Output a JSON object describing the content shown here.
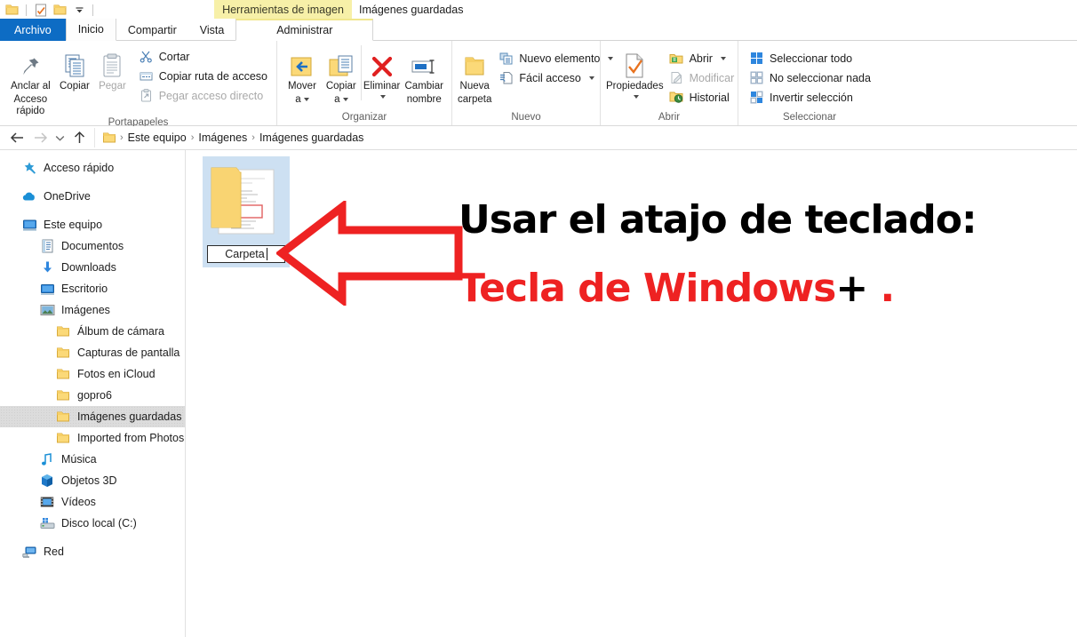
{
  "window": {
    "title": "Imágenes guardadas",
    "contextual_tab_header": "Herramientas de imagen",
    "quick_access": [
      {
        "name": "folder-icon",
        "label": "Carpeta"
      },
      {
        "name": "properties-icon",
        "label": "Propiedades"
      },
      {
        "name": "new-folder-icon",
        "label": "Nueva carpeta"
      },
      {
        "name": "chevron-down-icon",
        "label": "Personalizar barra de herramientas de acceso rápido"
      }
    ]
  },
  "tabs": [
    {
      "id": "archivo",
      "label": "Archivo",
      "state": "file"
    },
    {
      "id": "inicio",
      "label": "Inicio",
      "state": "active"
    },
    {
      "id": "compartir",
      "label": "Compartir",
      "state": "normal"
    },
    {
      "id": "vista",
      "label": "Vista",
      "state": "normal"
    },
    {
      "id": "administrar",
      "label": "Administrar",
      "state": "contextual"
    }
  ],
  "ribbon": {
    "groups": [
      {
        "id": "portapapeles",
        "label": "Portapapeles",
        "big_buttons": [
          {
            "id": "anclar",
            "icon": "pin-icon",
            "line1": "Anclar al",
            "line2": "Acceso rápido",
            "enabled": true
          },
          {
            "id": "copiar",
            "icon": "copy-icon",
            "line1": "Copiar",
            "line2": "",
            "enabled": true
          },
          {
            "id": "pegar",
            "icon": "paste-icon",
            "line1": "Pegar",
            "line2": "",
            "enabled": false
          }
        ],
        "small_buttons": [
          {
            "id": "cortar",
            "icon": "scissors-icon",
            "label": "Cortar",
            "enabled": true
          },
          {
            "id": "copiar-ruta",
            "icon": "copy-path-icon",
            "label": "Copiar ruta de acceso",
            "enabled": true
          },
          {
            "id": "pegar-acceso",
            "icon": "paste-shortcut-icon",
            "label": "Pegar acceso directo",
            "enabled": false
          }
        ]
      },
      {
        "id": "organizar",
        "label": "Organizar",
        "big_buttons": [
          {
            "id": "mover-a",
            "icon": "move-to-icon",
            "line1": "Mover",
            "line2": "a",
            "enabled": true,
            "dropdown": true
          },
          {
            "id": "copiar-a",
            "icon": "copy-to-icon",
            "line1": "Copiar",
            "line2": "a",
            "enabled": true,
            "dropdown": true
          },
          {
            "id": "eliminar",
            "icon": "delete-icon",
            "line1": "Eliminar",
            "line2": "",
            "enabled": true,
            "dropdown": true
          },
          {
            "id": "cambiar-nombre",
            "icon": "rename-icon",
            "line1": "Cambiar",
            "line2": "nombre",
            "enabled": true
          }
        ],
        "small_buttons": []
      },
      {
        "id": "nuevo",
        "label": "Nuevo",
        "big_buttons": [
          {
            "id": "nueva-carpeta",
            "icon": "new-folder-icon",
            "line1": "Nueva",
            "line2": "carpeta",
            "enabled": true
          }
        ],
        "small_buttons": [
          {
            "id": "nuevo-elemento",
            "icon": "new-item-icon",
            "label": "Nuevo elemento",
            "enabled": true,
            "dropdown": true
          },
          {
            "id": "facil-acceso",
            "icon": "easy-access-icon",
            "label": "Fácil acceso",
            "enabled": true,
            "dropdown": true
          }
        ]
      },
      {
        "id": "abrir",
        "label": "Abrir",
        "big_buttons": [
          {
            "id": "propiedades",
            "icon": "properties-icon",
            "line1": "Propiedades",
            "line2": "",
            "enabled": true,
            "dropdown": true
          }
        ],
        "small_buttons": [
          {
            "id": "abrir",
            "icon": "open-icon",
            "label": "Abrir",
            "enabled": true,
            "dropdown": true
          },
          {
            "id": "modificar",
            "icon": "edit-icon",
            "label": "Modificar",
            "enabled": false
          },
          {
            "id": "historial",
            "icon": "history-icon",
            "label": "Historial",
            "enabled": true
          }
        ]
      },
      {
        "id": "seleccionar",
        "label": "Seleccionar",
        "big_buttons": [],
        "small_buttons": [
          {
            "id": "seleccionar-todo",
            "icon": "select-all-icon",
            "label": "Seleccionar todo",
            "enabled": true
          },
          {
            "id": "no-seleccionar-nada",
            "icon": "select-none-icon",
            "label": "No seleccionar nada",
            "enabled": true
          },
          {
            "id": "invertir-seleccion",
            "icon": "invert-selection-icon",
            "label": "Invertir selección",
            "enabled": true
          }
        ]
      }
    ]
  },
  "address_bar": {
    "back": "Atrás",
    "forward": "Adelante",
    "recent": "Ubicaciones recientes",
    "up": "Subir un nivel",
    "breadcrumbs": [
      "Este equipo",
      "Imágenes",
      "Imágenes guardadas"
    ],
    "separator": "›"
  },
  "sidebar": {
    "items": [
      {
        "id": "acceso-rapido",
        "label": "Acceso rápido",
        "icon": "star-pin-icon",
        "indent": 0,
        "selected": false,
        "spacer_after": true
      },
      {
        "id": "onedrive",
        "label": "OneDrive",
        "icon": "cloud-icon",
        "indent": 0,
        "selected": false,
        "spacer_after": true
      },
      {
        "id": "este-equipo",
        "label": "Este equipo",
        "icon": "computer-icon",
        "indent": 0,
        "selected": false,
        "spacer_after": false
      },
      {
        "id": "documentos",
        "label": "Documentos",
        "icon": "documents-icon",
        "indent": 1,
        "selected": false,
        "spacer_after": false
      },
      {
        "id": "downloads",
        "label": "Downloads",
        "icon": "download-icon",
        "indent": 1,
        "selected": false,
        "spacer_after": false
      },
      {
        "id": "escritorio",
        "label": "Escritorio",
        "icon": "desktop-icon",
        "indent": 1,
        "selected": false,
        "spacer_after": false
      },
      {
        "id": "imagenes",
        "label": "Imágenes",
        "icon": "pictures-icon",
        "indent": 1,
        "selected": false,
        "spacer_after": false
      },
      {
        "id": "album-de-camara",
        "label": "Álbum de cámara",
        "icon": "folder-icon",
        "indent": 2,
        "selected": false,
        "spacer_after": false
      },
      {
        "id": "capturas-de-pantalla",
        "label": "Capturas de pantalla",
        "icon": "folder-icon",
        "indent": 2,
        "selected": false,
        "spacer_after": false
      },
      {
        "id": "fotos-en-icloud",
        "label": "Fotos en iCloud",
        "icon": "folder-icon",
        "indent": 2,
        "selected": false,
        "spacer_after": false
      },
      {
        "id": "gopro6",
        "label": "gopro6",
        "icon": "folder-icon",
        "indent": 2,
        "selected": false,
        "spacer_after": false
      },
      {
        "id": "imagenes-guardadas",
        "label": "Imágenes guardadas",
        "icon": "folder-icon",
        "indent": 2,
        "selected": true,
        "spacer_after": false
      },
      {
        "id": "imported-from-photos",
        "label": "Imported from Photos Com",
        "icon": "folder-icon",
        "indent": 2,
        "selected": false,
        "spacer_after": false
      },
      {
        "id": "musica",
        "label": "Música",
        "icon": "music-icon",
        "indent": 1,
        "selected": false,
        "spacer_after": false
      },
      {
        "id": "objetos-3d",
        "label": "Objetos 3D",
        "icon": "objects3d-icon",
        "indent": 1,
        "selected": false,
        "spacer_after": false
      },
      {
        "id": "videos",
        "label": "Vídeos",
        "icon": "videos-icon",
        "indent": 1,
        "selected": false,
        "spacer_after": false
      },
      {
        "id": "disco-local-c",
        "label": "Disco local (C:)",
        "icon": "drive-icon",
        "indent": 1,
        "selected": false,
        "spacer_after": true
      },
      {
        "id": "red",
        "label": "Red",
        "icon": "network-icon",
        "indent": 0,
        "selected": false,
        "spacer_after": false
      }
    ]
  },
  "content": {
    "item": {
      "id": "carpeta",
      "icon": "folder-with-document-thumbnail",
      "rename_value": "Carpeta",
      "selected": true,
      "renaming": true
    }
  },
  "annotation": {
    "arrow": "left-block-arrow",
    "arrow_color": "#ee2222",
    "line1": "Usar el atajo de teclado:",
    "line1_color": "#000000",
    "line2_part1": "Tecla de Windows",
    "line2_plus": "+",
    "line2_part2": ".",
    "line2_color": "#ee2222"
  },
  "colors": {
    "accent_blue": "#0d6cc4",
    "contextual_yellow": "#f7f0a8",
    "selection_blue": "#cde0f2",
    "annotation_red": "#ee2222",
    "folder_yellow": "#fbd978"
  }
}
